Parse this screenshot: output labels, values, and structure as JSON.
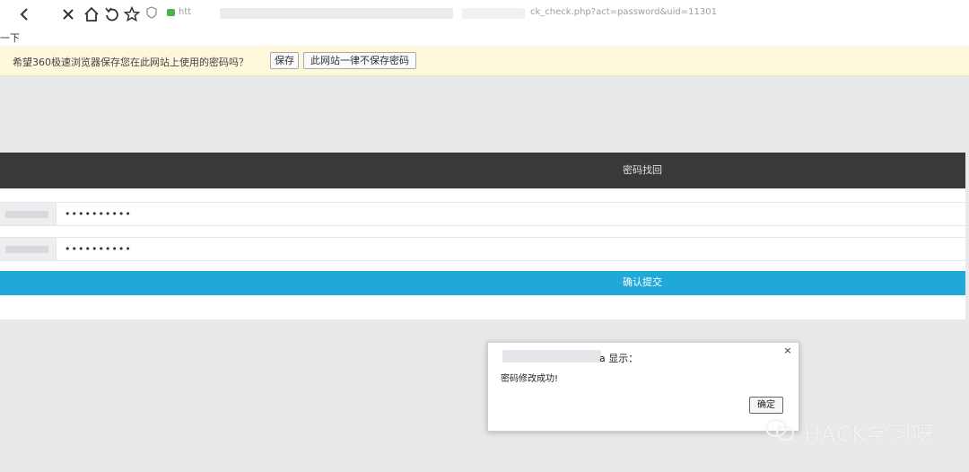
{
  "browser": {
    "url_prefix": "htt",
    "url_visible_part": "ck_check.php?act=password&uid=11301"
  },
  "page": {
    "fragment_text": "一下"
  },
  "save_bar": {
    "message": "希望360极速浏览器保存您在此网站上使用的密码吗？",
    "save_button": "保存",
    "never_button": "此网站一律不保存密码"
  },
  "header": {
    "title": "密码找回"
  },
  "form": {
    "password_value": "••••••••••",
    "confirm_value": "••••••••••",
    "submit_label": "确认提交"
  },
  "dialog": {
    "title_suffix": "a 显示：",
    "message": "密码修改成功!",
    "ok_label": "确定",
    "close_symbol": "×"
  },
  "watermark": {
    "text": "HACK学习呀"
  }
}
